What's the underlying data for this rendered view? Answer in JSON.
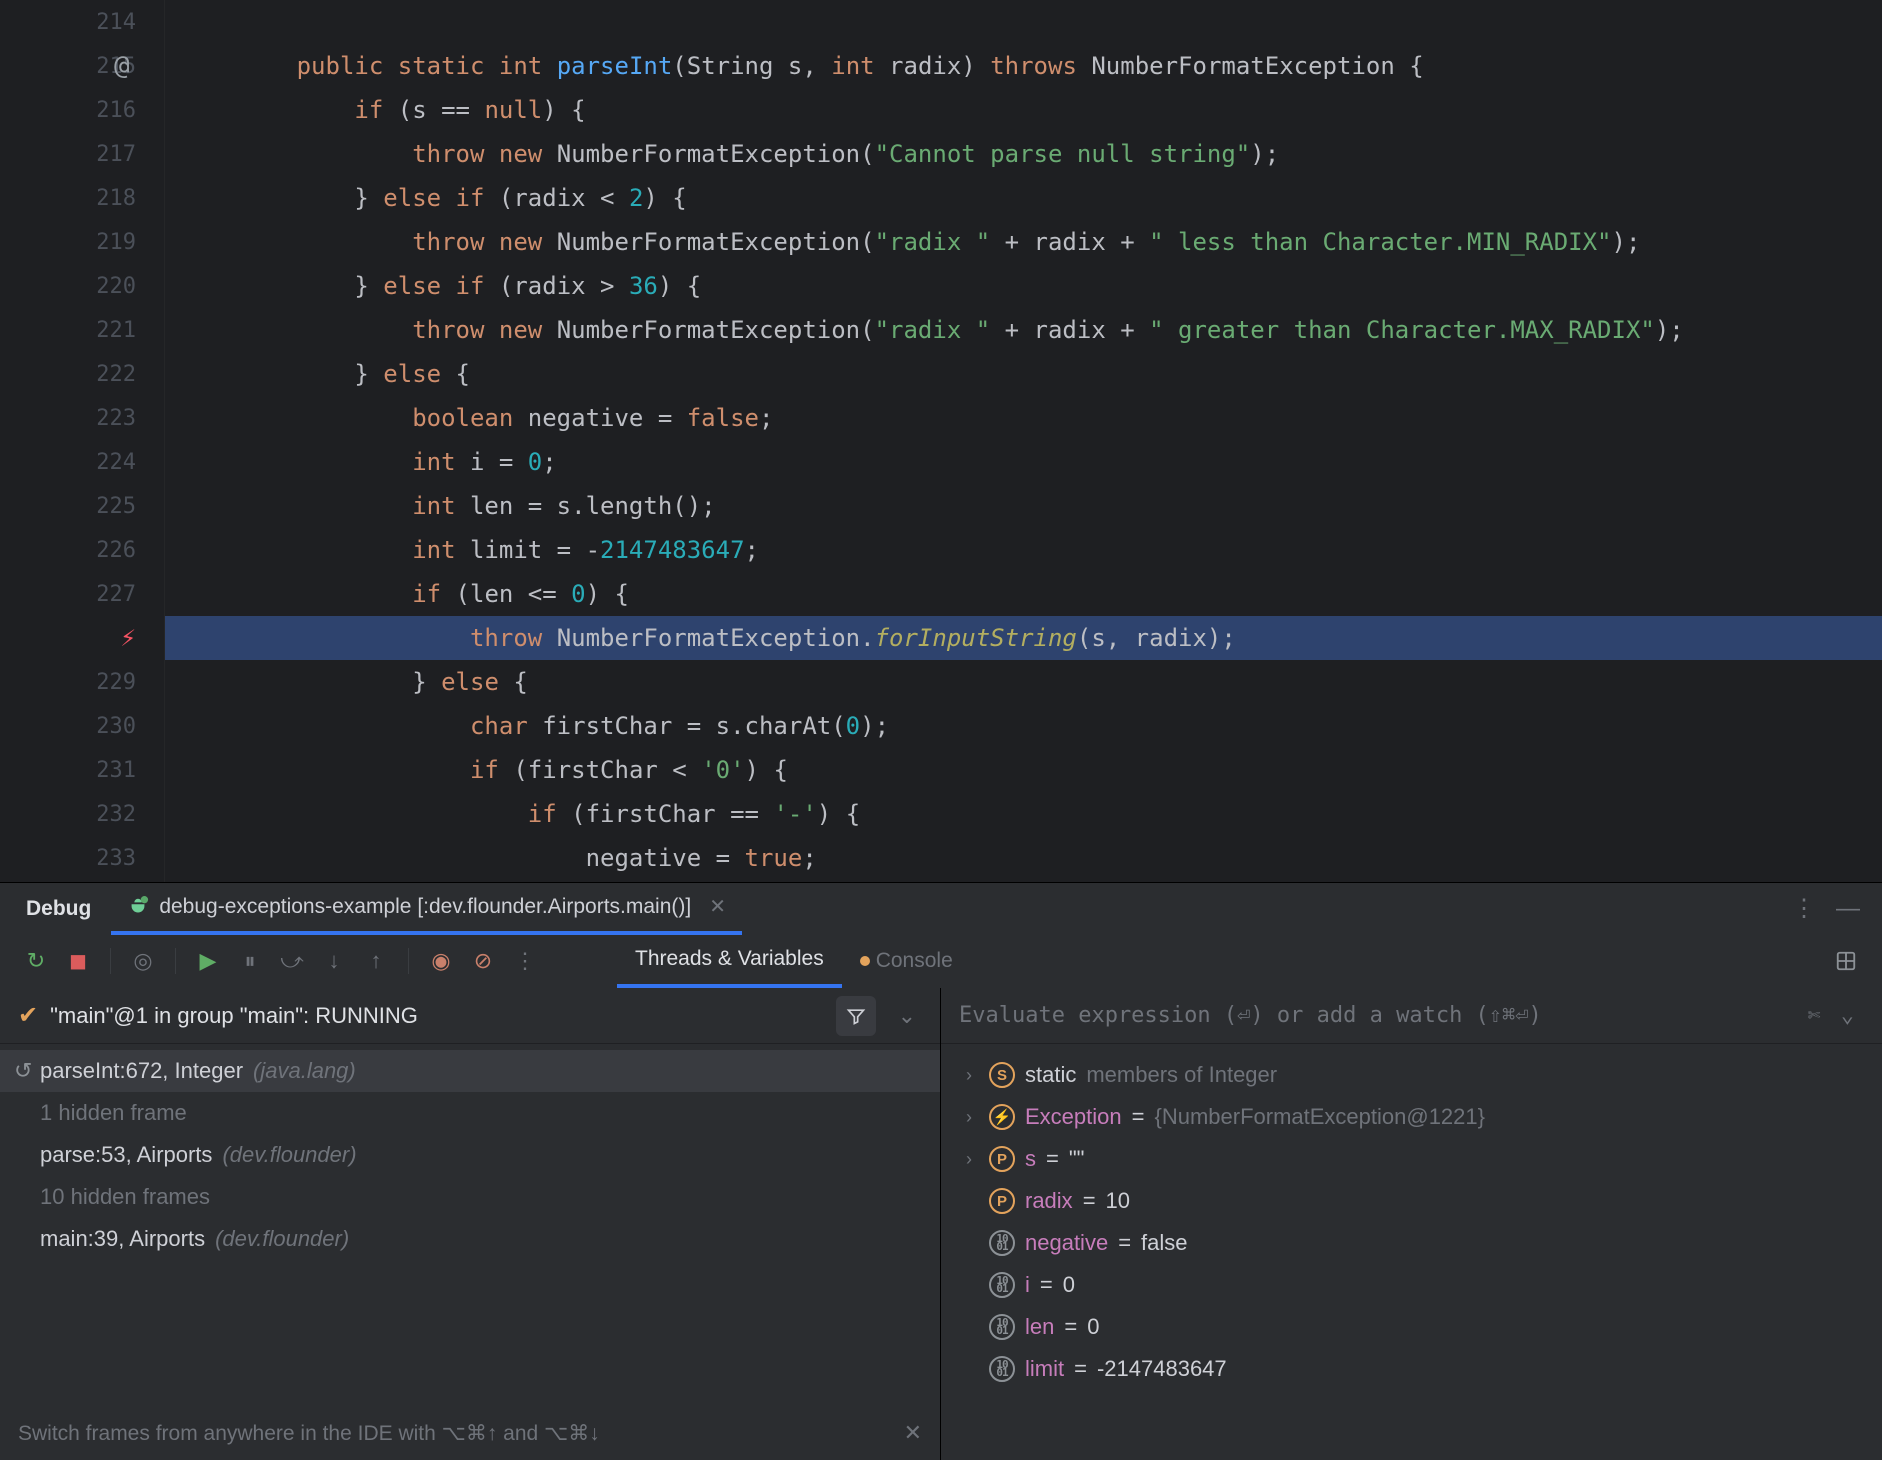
{
  "gutter": {
    "lines": [
      214,
      215,
      216,
      217,
      218,
      219,
      220,
      221,
      222,
      223,
      224,
      225,
      226,
      227,
      null,
      229,
      230,
      231,
      232,
      233
    ],
    "annotation_line_index": 1,
    "breakpoint_index": 14
  },
  "code": [
    {
      "indent": 0,
      "tokens": []
    },
    {
      "indent": 0,
      "tokens": [
        {
          "t": "public ",
          "c": "kw"
        },
        {
          "t": "static ",
          "c": "kw"
        },
        {
          "t": "int ",
          "c": "kw"
        },
        {
          "t": "parseInt",
          "c": "fn"
        },
        {
          "t": "(String s, ",
          "c": ""
        },
        {
          "t": "int ",
          "c": "kw"
        },
        {
          "t": "radix) ",
          "c": ""
        },
        {
          "t": "throws ",
          "c": "kw"
        },
        {
          "t": "NumberFormatException {",
          "c": ""
        }
      ]
    },
    {
      "indent": 1,
      "tokens": [
        {
          "t": "if ",
          "c": "kw"
        },
        {
          "t": "(s == ",
          "c": ""
        },
        {
          "t": "null",
          "c": "kw"
        },
        {
          "t": ") {",
          "c": ""
        }
      ]
    },
    {
      "indent": 2,
      "tokens": [
        {
          "t": "throw ",
          "c": "kw"
        },
        {
          "t": "new ",
          "c": "kw"
        },
        {
          "t": "NumberFormatException(",
          "c": ""
        },
        {
          "t": "\"Cannot parse null string\"",
          "c": "str"
        },
        {
          "t": ");",
          "c": ""
        }
      ]
    },
    {
      "indent": 1,
      "tokens": [
        {
          "t": "} ",
          "c": ""
        },
        {
          "t": "else if ",
          "c": "kw"
        },
        {
          "t": "(radix < ",
          "c": ""
        },
        {
          "t": "2",
          "c": "num"
        },
        {
          "t": ") {",
          "c": ""
        }
      ]
    },
    {
      "indent": 2,
      "tokens": [
        {
          "t": "throw ",
          "c": "kw"
        },
        {
          "t": "new ",
          "c": "kw"
        },
        {
          "t": "NumberFormatException(",
          "c": ""
        },
        {
          "t": "\"radix \"",
          "c": "str"
        },
        {
          "t": " + radix + ",
          "c": ""
        },
        {
          "t": "\" less than Character.MIN_RADIX\"",
          "c": "str"
        },
        {
          "t": ");",
          "c": ""
        }
      ]
    },
    {
      "indent": 1,
      "tokens": [
        {
          "t": "} ",
          "c": ""
        },
        {
          "t": "else if ",
          "c": "kw"
        },
        {
          "t": "(radix > ",
          "c": ""
        },
        {
          "t": "36",
          "c": "num"
        },
        {
          "t": ") {",
          "c": ""
        }
      ]
    },
    {
      "indent": 2,
      "tokens": [
        {
          "t": "throw ",
          "c": "kw"
        },
        {
          "t": "new ",
          "c": "kw"
        },
        {
          "t": "NumberFormatException(",
          "c": ""
        },
        {
          "t": "\"radix \"",
          "c": "str"
        },
        {
          "t": " + radix + ",
          "c": ""
        },
        {
          "t": "\" greater than Character.MAX_RADIX\"",
          "c": "str"
        },
        {
          "t": ");",
          "c": ""
        }
      ]
    },
    {
      "indent": 1,
      "tokens": [
        {
          "t": "} ",
          "c": ""
        },
        {
          "t": "else ",
          "c": "kw"
        },
        {
          "t": "{",
          "c": ""
        }
      ]
    },
    {
      "indent": 2,
      "tokens": [
        {
          "t": "boolean ",
          "c": "kw"
        },
        {
          "t": "negative = ",
          "c": ""
        },
        {
          "t": "false",
          "c": "kw"
        },
        {
          "t": ";",
          "c": ""
        }
      ]
    },
    {
      "indent": 2,
      "tokens": [
        {
          "t": "int ",
          "c": "kw"
        },
        {
          "t": "i = ",
          "c": ""
        },
        {
          "t": "0",
          "c": "num"
        },
        {
          "t": ";",
          "c": ""
        }
      ]
    },
    {
      "indent": 2,
      "tokens": [
        {
          "t": "int ",
          "c": "kw"
        },
        {
          "t": "len = s.length();",
          "c": ""
        }
      ]
    },
    {
      "indent": 2,
      "tokens": [
        {
          "t": "int ",
          "c": "kw"
        },
        {
          "t": "limit = -",
          "c": ""
        },
        {
          "t": "2147483647",
          "c": "num"
        },
        {
          "t": ";",
          "c": ""
        }
      ]
    },
    {
      "indent": 2,
      "tokens": [
        {
          "t": "if ",
          "c": "kw"
        },
        {
          "t": "(len <= ",
          "c": ""
        },
        {
          "t": "0",
          "c": "num"
        },
        {
          "t": ") {",
          "c": ""
        }
      ]
    },
    {
      "indent": 3,
      "hl": true,
      "tokens": [
        {
          "t": "throw ",
          "c": "kw"
        },
        {
          "t": "NumberFormatException.",
          "c": ""
        },
        {
          "t": "forInputString",
          "c": "fni"
        },
        {
          "t": "(s, radix);",
          "c": ""
        }
      ]
    },
    {
      "indent": 2,
      "tokens": [
        {
          "t": "} ",
          "c": ""
        },
        {
          "t": "else ",
          "c": "kw"
        },
        {
          "t": "{",
          "c": ""
        }
      ]
    },
    {
      "indent": 3,
      "tokens": [
        {
          "t": "char ",
          "c": "kw"
        },
        {
          "t": "firstChar = s.charAt(",
          "c": ""
        },
        {
          "t": "0",
          "c": "num"
        },
        {
          "t": ");",
          "c": ""
        }
      ]
    },
    {
      "indent": 3,
      "tokens": [
        {
          "t": "if ",
          "c": "kw"
        },
        {
          "t": "(firstChar < ",
          "c": ""
        },
        {
          "t": "'0'",
          "c": "str"
        },
        {
          "t": ") {",
          "c": ""
        }
      ]
    },
    {
      "indent": 4,
      "tokens": [
        {
          "t": "if ",
          "c": "kw"
        },
        {
          "t": "(firstChar == ",
          "c": ""
        },
        {
          "t": "'-'",
          "c": "str"
        },
        {
          "t": ") {",
          "c": ""
        }
      ]
    },
    {
      "indent": 5,
      "tokens": [
        {
          "t": "negative = ",
          "c": ""
        },
        {
          "t": "true",
          "c": "kw"
        },
        {
          "t": ";",
          "c": ""
        }
      ]
    }
  ],
  "tool_header": {
    "title": "Debug",
    "run_tab": "debug-exceptions-example [:dev.flounder.Airports.main()]"
  },
  "toolbar": {
    "tabs": {
      "threads": "Threads & Variables",
      "console": "Console"
    }
  },
  "thread_status": "\"main\"@1 in group \"main\": RUNNING",
  "frames": [
    {
      "sel": true,
      "undo": true,
      "main": "parseInt:672, Integer ",
      "dim": "(java.lang)"
    },
    {
      "dim2": "1 hidden frame"
    },
    {
      "main": "parse:53, Airports ",
      "dim": "(dev.flounder)"
    },
    {
      "dim2": "10 hidden frames"
    },
    {
      "main": "main:39, Airports ",
      "dim": "(dev.flounder)"
    }
  ],
  "tip": "Switch frames from anywhere in the IDE with ⌥⌘↑ and ⌥⌘↓",
  "eval_placeholder": "Evaluate expression (⏎) or add a watch (⇧⌘⏎)",
  "vars": [
    {
      "chev": true,
      "badge": "S",
      "name_plain": "static",
      "extra_dim": " members of Integer"
    },
    {
      "chev": true,
      "badge": "⚡",
      "name": "Exception",
      "eq": " = ",
      "val_dim": "{NumberFormatException@1221}"
    },
    {
      "chev": true,
      "badge": "P",
      "name": "s",
      "eq": " = ",
      "val": "\"\""
    },
    {
      "chev": false,
      "badge": "P",
      "name": "radix",
      "eq": " = ",
      "val": "10"
    },
    {
      "chev": false,
      "badge": "01",
      "mono": true,
      "name": "negative",
      "eq": " = ",
      "val": "false"
    },
    {
      "chev": false,
      "badge": "01",
      "mono": true,
      "name": "i",
      "eq": " = ",
      "val": "0"
    },
    {
      "chev": false,
      "badge": "01",
      "mono": true,
      "name": "len",
      "eq": " = ",
      "val": "0"
    },
    {
      "chev": false,
      "badge": "01",
      "mono": true,
      "name": "limit",
      "eq": " = ",
      "val": "-2147483647"
    }
  ]
}
